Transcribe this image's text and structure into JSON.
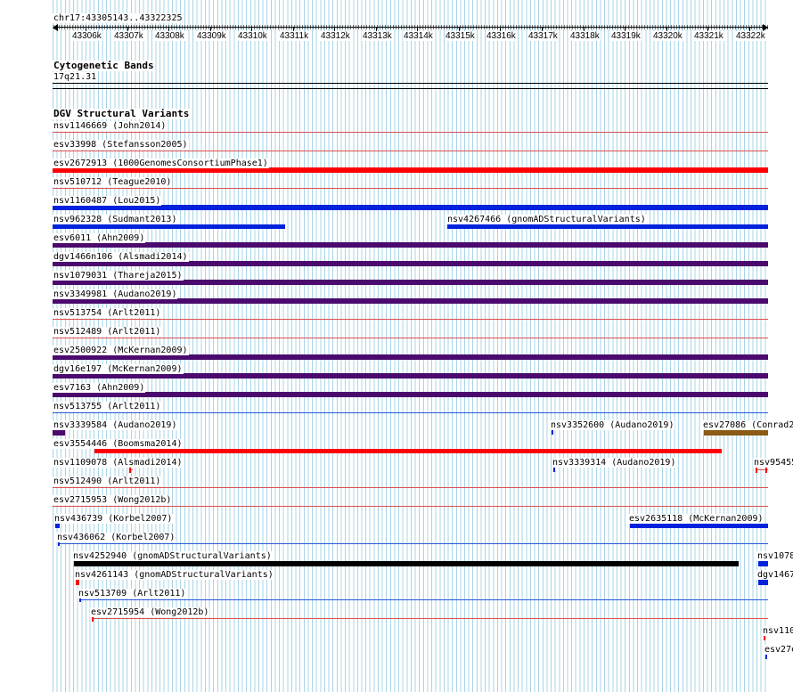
{
  "ruler": {
    "position": "chr17:43305143..43322325",
    "ticks": [
      "43306k",
      "43307k",
      "43308k",
      "43309k",
      "43310k",
      "43311k",
      "43312k",
      "43313k",
      "43314k",
      "43315k",
      "43316k",
      "43317k",
      "43318k",
      "43319k",
      "43320k",
      "43321k",
      "43322k"
    ]
  },
  "cytobands": {
    "title": "Cytogenetic Bands",
    "band": "17q21.31"
  },
  "dgv": {
    "title": "DGV Structural Variants",
    "colors": {
      "loss": "#ff0000",
      "gain": "#0022dd",
      "both": "#4b0a6e",
      "complex": "#8b5a14",
      "inversion": "#000000"
    },
    "labels": [
      "nsv1146669 (John2014)",
      "esv33998 (Stefansson2005)",
      "esv2672913 (1000GenomesConsortiumPhase1)",
      "nsv510712 (Teague2010)",
      "nsv1160487 (Lou2015)",
      "nsv962328 (Sudmant2013)",
      "nsv4267466 (gnomADStructuralVariants)",
      "esv6011 (Ahn2009)",
      "dgv1466n106 (Alsmadi2014)",
      "nsv1079031 (Thareja2015)",
      "nsv3349981 (Audano2019)",
      "nsv513754 (Arlt2011)",
      "nsv512489 (Arlt2011)",
      "esv2500922 (McKernan2009)",
      "dgv16e197 (McKernan2009)",
      "esv7163 (Ahn2009)",
      "nsv513755 (Arlt2011)",
      "nsv3339584 (Audano2019)",
      "nsv3352600 (Audano2019)",
      "esv27086 (Conrad2",
      "esv3554446 (Boomsma2014)",
      "nsv1109078 (Alsmadi2014)",
      "nsv3339314 (Audano2019)",
      "nsv95455",
      "nsv512490 (Arlt2011)",
      "esv2715953 (Wong2012b)",
      "nsv436739 (Korbel2007)",
      "esv2635118 (McKernan2009)",
      "nsv436062 (Korbel2007)",
      "nsv4252940 (gnomADStructuralVariants)",
      "nsv1078",
      "nsv4261143 (gnomADStructuralVariants)",
      "dgv1467",
      "nsv513709 (Arlt2011)",
      "esv2715954 (Wong2012b)",
      "nsv110",
      "esv27e"
    ]
  }
}
